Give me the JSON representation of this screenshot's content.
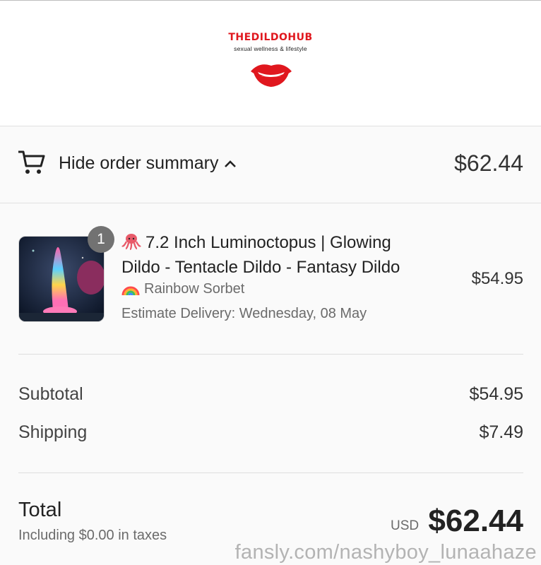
{
  "brand": {
    "name": "THEDILDOHUB",
    "tagline": "sexual wellness & lifestyle",
    "accent_color": "#e0171e"
  },
  "summary": {
    "toggle_label": "Hide order summary",
    "total": "$62.44",
    "icons": [
      "cart-icon",
      "chevron-up-icon"
    ]
  },
  "item": {
    "quantity": "1",
    "title": "7.2 Inch Luminoctopus | Glowing Dildo - Tentacle Dildo - Fantasy Dildo",
    "title_icon": "octopus-emoji",
    "variant": "Rainbow Sorbet",
    "variant_icon": "rainbow-emoji",
    "delivery": "Estimate Delivery: Wednesday, 08 May",
    "price": "$54.95"
  },
  "costs": {
    "subtotal_label": "Subtotal",
    "subtotal_value": "$54.95",
    "shipping_label": "Shipping",
    "shipping_value": "$7.49"
  },
  "total": {
    "label": "Total",
    "tax_note": "Including $0.00 in taxes",
    "currency": "USD",
    "amount": "$62.44"
  },
  "watermark": "fansly.com/nashyboy_lunaahaze"
}
